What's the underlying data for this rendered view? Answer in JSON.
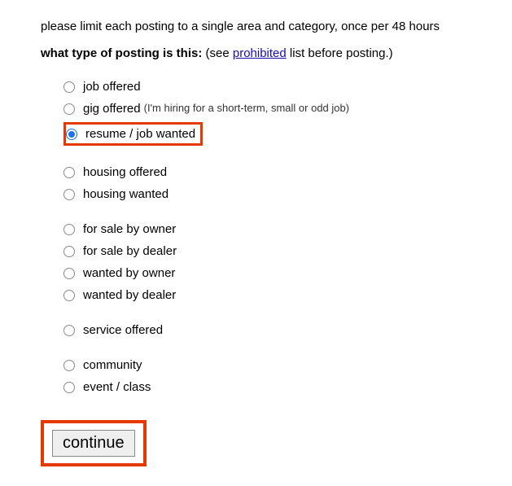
{
  "header": {
    "limit_text": "please limit each posting to a single area and category, once per 48 hours",
    "question_bold": "what type of posting is this:",
    "see_prefix": " (see ",
    "prohibited_link": "prohibited",
    "see_suffix": " list before posting.)"
  },
  "groups": [
    {
      "items": [
        {
          "id": "job-offered",
          "label": "job offered",
          "note": "",
          "checked": false,
          "highlighted": false
        },
        {
          "id": "gig-offered",
          "label": "gig offered",
          "note": "(I'm hiring for a short-term, small or odd job)",
          "checked": false,
          "highlighted": false
        },
        {
          "id": "resume-job-wanted",
          "label": "resume / job wanted",
          "note": "",
          "checked": true,
          "highlighted": true
        }
      ]
    },
    {
      "items": [
        {
          "id": "housing-offered",
          "label": "housing offered",
          "note": "",
          "checked": false,
          "highlighted": false
        },
        {
          "id": "housing-wanted",
          "label": "housing wanted",
          "note": "",
          "checked": false,
          "highlighted": false
        }
      ]
    },
    {
      "items": [
        {
          "id": "for-sale-by-owner",
          "label": "for sale by owner",
          "note": "",
          "checked": false,
          "highlighted": false
        },
        {
          "id": "for-sale-by-dealer",
          "label": "for sale by dealer",
          "note": "",
          "checked": false,
          "highlighted": false
        },
        {
          "id": "wanted-by-owner",
          "label": "wanted by owner",
          "note": "",
          "checked": false,
          "highlighted": false
        },
        {
          "id": "wanted-by-dealer",
          "label": "wanted by dealer",
          "note": "",
          "checked": false,
          "highlighted": false
        }
      ]
    },
    {
      "items": [
        {
          "id": "service-offered",
          "label": "service offered",
          "note": "",
          "checked": false,
          "highlighted": false
        }
      ]
    },
    {
      "items": [
        {
          "id": "community",
          "label": "community",
          "note": "",
          "checked": false,
          "highlighted": false
        },
        {
          "id": "event-class",
          "label": "event / class",
          "note": "",
          "checked": false,
          "highlighted": false
        }
      ]
    }
  ],
  "continue_label": "continue"
}
